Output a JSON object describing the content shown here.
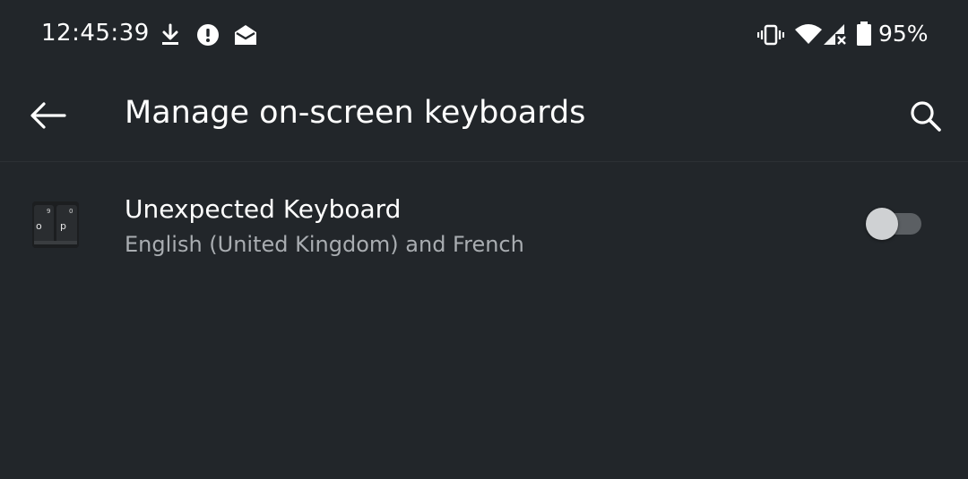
{
  "status_bar": {
    "time": "12:45:39",
    "battery_percent": "95%",
    "icons": [
      "download-icon",
      "alert-icon",
      "mail-icon",
      "vibrate-icon",
      "wifi-icon",
      "signal-icon",
      "battery-icon"
    ]
  },
  "app_bar": {
    "title": "Manage on-screen keyboards",
    "back_icon": "arrow-left-icon",
    "search_icon": "search-icon"
  },
  "keyboards": [
    {
      "name": "Unexpected Keyboard",
      "languages": "English (United Kingdom) and French",
      "enabled": false,
      "icon_keys": [
        "9",
        "0",
        "o",
        "p"
      ]
    }
  ],
  "colors": {
    "background": "#22262a",
    "text_primary": "#ffffff",
    "text_secondary": "#a9adb1",
    "toggle_track_off": "#5b5f63",
    "toggle_thumb_off": "#cfd1d3"
  }
}
